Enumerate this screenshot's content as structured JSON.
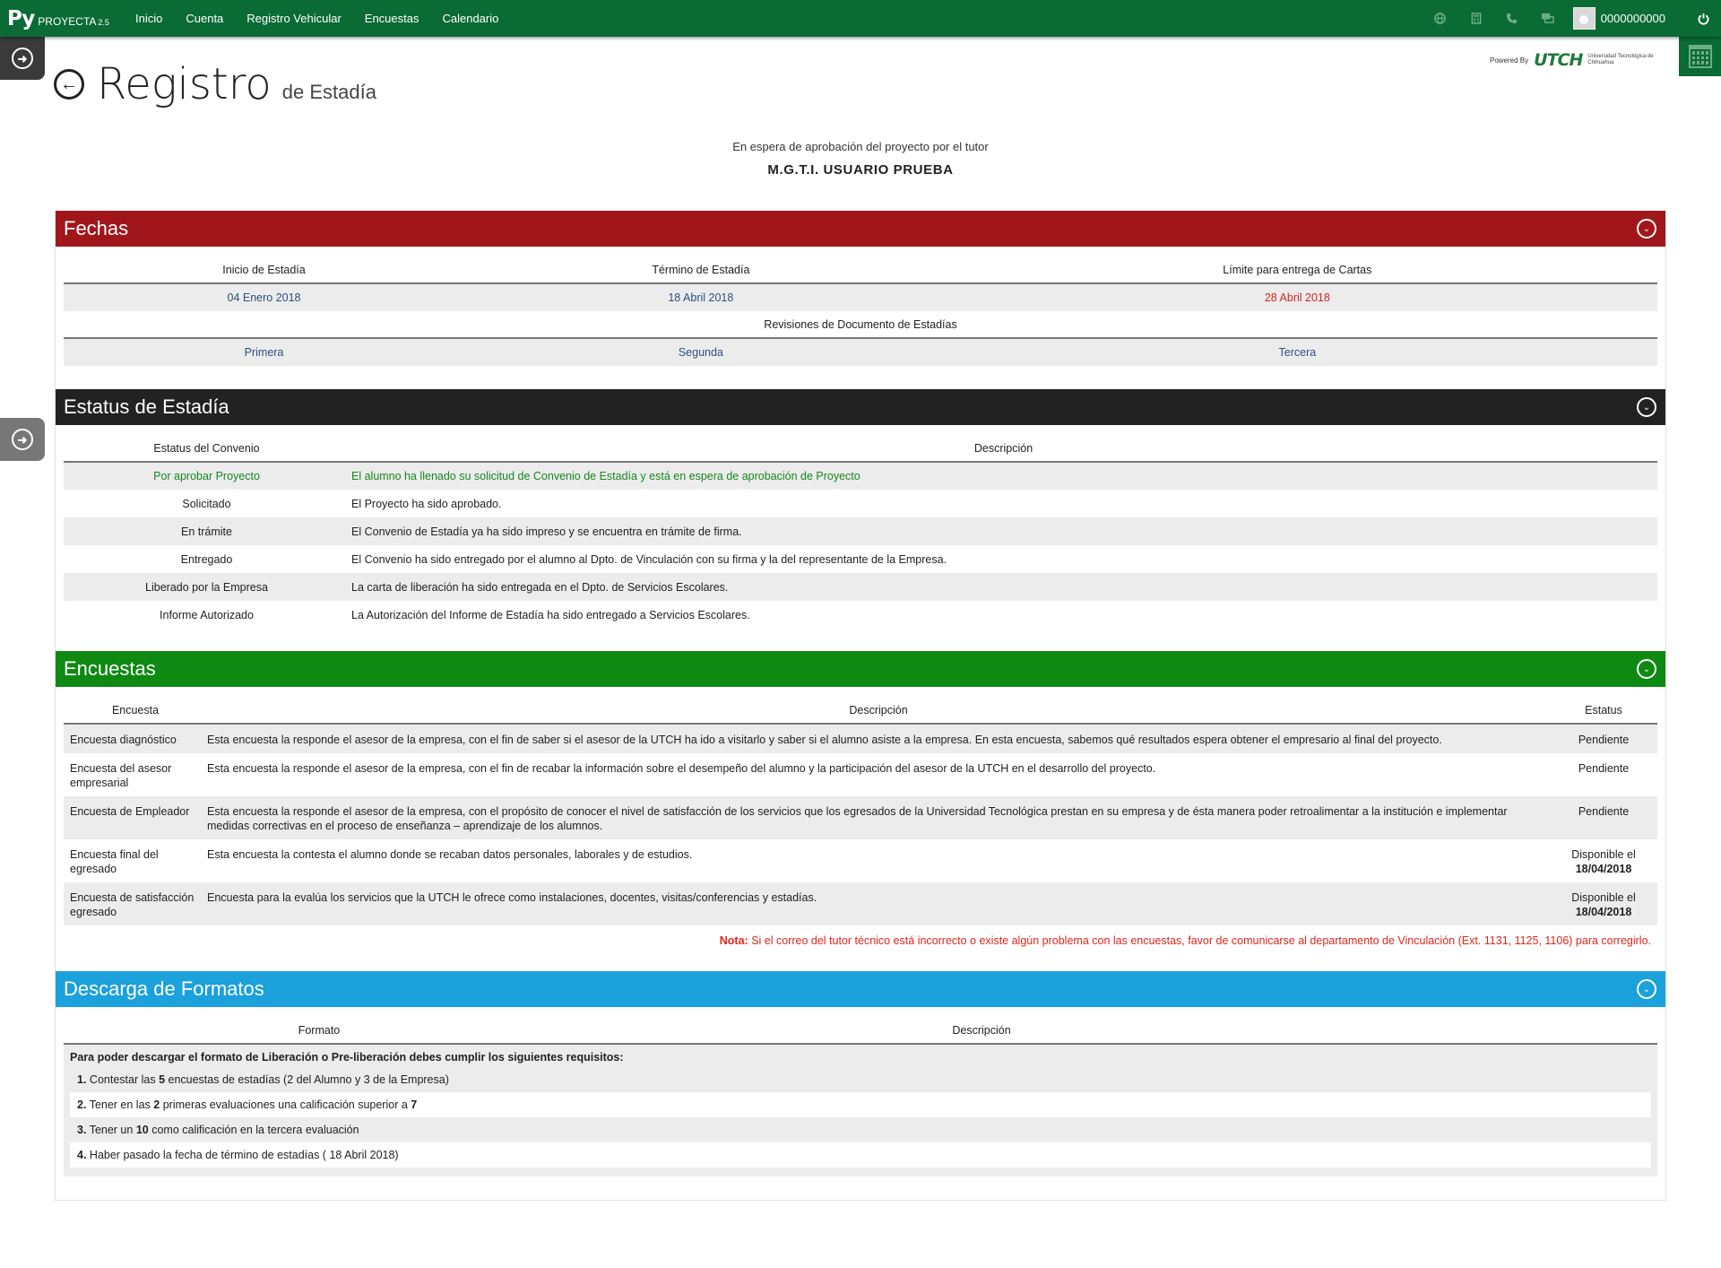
{
  "brand": {
    "logo": "Py",
    "name": "PROYECTA",
    "version": "2.5"
  },
  "nav": [
    "Inicio",
    "Cuenta",
    "Registro Vehicular",
    "Encuestas",
    "Calendario"
  ],
  "user": {
    "name": "0000000000"
  },
  "powered_by": {
    "label": "Powered By",
    "logo": "UTCH",
    "institution": "Universidad Tecnológica de Chihuahua"
  },
  "page": {
    "title": "Registro",
    "subtitle": "de Estadía"
  },
  "approval": {
    "message": "En espera de aprobación del proyecto por el tutor",
    "tutor": "M.G.T.I. USUARIO PRUEBA"
  },
  "colors": {
    "topbar": "#0b6b35",
    "fechas": "#a0161b",
    "estatus": "#222222",
    "encuestas": "#0e8a12",
    "descarga": "#1ba1dc"
  },
  "fechas": {
    "title": "Fechas",
    "headers": [
      "Inicio de Estadía",
      "Término de Estadía",
      "Límite para entrega de Cartas"
    ],
    "values": [
      "04 Enero 2018",
      "18 Abril 2018",
      "28 Abril 2018"
    ],
    "revisiones_title": "Revisiones de Documento de Estadías",
    "revisiones": [
      "Primera",
      "Segunda",
      "Tercera"
    ]
  },
  "estatus": {
    "title": "Estatus de Estadía",
    "headers": [
      "Estatus del Convenio",
      "Descripción"
    ],
    "rows": [
      {
        "status": "Por aprobar Proyecto",
        "desc": "El alumno ha llenado su solicitud de Convenio de Estadía y está en espera de aprobación de Proyecto"
      },
      {
        "status": "Solicitado",
        "desc": "El Proyecto ha sido aprobado."
      },
      {
        "status": "En trámite",
        "desc": "El Convenio de Estadía ya ha sido impreso y se encuentra en trámite de firma."
      },
      {
        "status": "Entregado",
        "desc": "El Convenio ha sido entregado por el alumno al Dpto. de Vinculación con su firma y la del representante de la Empresa."
      },
      {
        "status": "Liberado por la Empresa",
        "desc": "La carta de liberación ha sido entregada en el Dpto. de Servicios Escolares."
      },
      {
        "status": "Informe Autorizado",
        "desc": "La Autorización del Informe de Estadía ha sido entregado a Servicios Escolares."
      }
    ]
  },
  "encuestas": {
    "title": "Encuestas",
    "headers": [
      "Encuesta",
      "Descripción",
      "Estatus"
    ],
    "rows": [
      {
        "name": "Encuesta diagnóstico",
        "desc": "Esta encuesta la responde el asesor de la empresa, con el fin de saber si el asesor de la UTCH ha ido a visitarlo y saber si el alumno asiste a la empresa. En esta encuesta, sabemos qué resultados espera obtener el empresario al final del proyecto.",
        "status": "Pendiente",
        "date": ""
      },
      {
        "name": "Encuesta del asesor empresarial",
        "desc": "Esta encuesta la responde el asesor de la empresa, con el fin de recabar la información sobre el desempeño del alumno y la participación del asesor de la UTCH en el desarrollo del proyecto.",
        "status": "Pendiente",
        "date": ""
      },
      {
        "name": "Encuesta de Empleador",
        "desc": "Esta encuesta la responde el asesor de la empresa, con el propósito de conocer el nivel de satisfacción de los servicios que los egresados de la Universidad Tecnológica prestan en su empresa y de ésta manera poder retroalimentar a la institución e implementar medidas correctivas en el proceso de enseñanza – aprendizaje de los alumnos.",
        "status": "Pendiente",
        "date": ""
      },
      {
        "name": "Encuesta final del egresado",
        "desc": "Esta encuesta la contesta el alumno donde se recaban datos personales, laborales y de estudios.",
        "status": "Disponible el",
        "date": "18/04/2018"
      },
      {
        "name": "Encuesta de satisfacción egresado",
        "desc": "Encuesta para la evalúa los servicios que la UTCH le ofrece como instalaciones, docentes, visitas/conferencias y estadías.",
        "status": "Disponible el",
        "date": "18/04/2018"
      }
    ],
    "nota_label": "Nota:",
    "nota": "Si el correo del tutor técnico está incorrecto o existe algún problema con las encuestas, favor de comunicarse al departamento de Vinculación (Ext. 1131, 1125, 1106) para corregirlo."
  },
  "descarga": {
    "title": "Descarga de Formatos",
    "headers": [
      "Formato",
      "Descripción"
    ],
    "req_title": "Para poder descargar el formato de Liberación o Pre-liberación debes cumplir los siguientes requisitos:",
    "requirements": [
      {
        "num": "1.",
        "pre": "Contestar las",
        "bold": "5",
        "post": "encuestas de estadías (2 del Alumno y 3 de la Empresa)"
      },
      {
        "num": "2.",
        "pre": "Tener en las",
        "bold": "2",
        "post": "primeras evaluaciones una calificación superior a",
        "bold2": "7"
      },
      {
        "num": "3.",
        "pre": "Tener un",
        "bold": "10",
        "post": "como calificación en la tercera evaluación"
      },
      {
        "num": "4.",
        "pre": "Haber pasado la fecha de término de estadías ( 18 Abril 2018)",
        "bold": "",
        "post": ""
      }
    ]
  }
}
